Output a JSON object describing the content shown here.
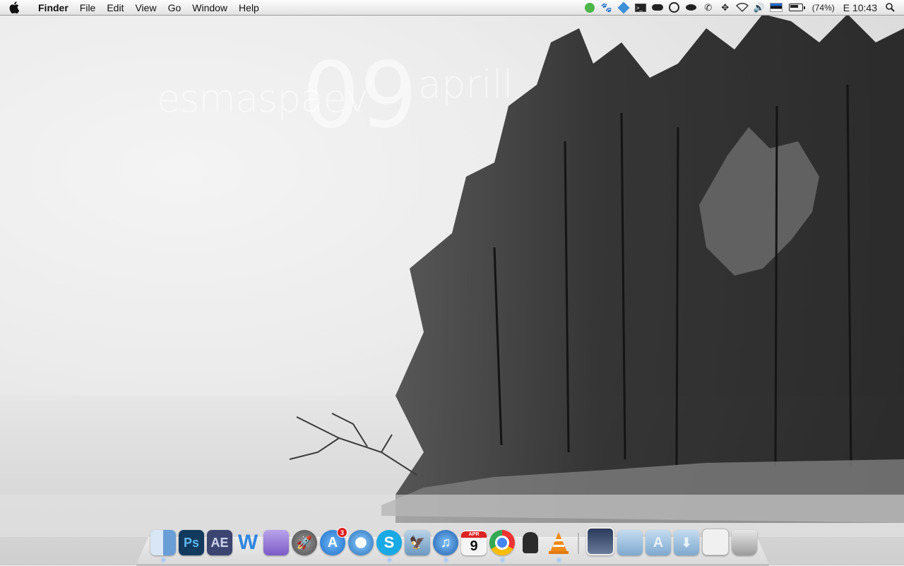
{
  "menubar": {
    "apple_icon": "apple-icon",
    "app_name": "Finder",
    "menus": [
      "File",
      "Edit",
      "View",
      "Go",
      "Window",
      "Help"
    ],
    "status_icons": [
      "evernote-icon",
      "paw-icon",
      "dropbox-icon",
      "terminal-icon",
      "cloud-icon",
      "sync-icon",
      "eye-icon",
      "phone-icon",
      "move-icon",
      "wifi-icon",
      "volume-icon",
      "estonian-flag-icon",
      "battery-icon",
      "search-icon"
    ],
    "battery_percent": "(74%)",
    "clock": "E 10:43"
  },
  "widget": {
    "day_name": "esmaspäev",
    "date_number": "09",
    "month_name": "aprill"
  },
  "dock": {
    "apps": [
      {
        "name": "finder-icon",
        "glyph": "",
        "color": "#6fa0d8",
        "running": true
      },
      {
        "name": "photoshop-icon",
        "glyph": "Ps",
        "color": "#1c3a5c"
      },
      {
        "name": "after-effects-icon",
        "glyph": "AE",
        "color": "#3d4f7a"
      },
      {
        "name": "word-icon",
        "glyph": "W",
        "color": "#2f7fd8"
      },
      {
        "name": "keynote-icon",
        "glyph": "",
        "color": "#8a72c6"
      },
      {
        "name": "launchpad-icon",
        "glyph": "",
        "color": "#7a7a7a"
      },
      {
        "name": "app-store-icon",
        "glyph": "",
        "color": "#2f86e0",
        "badge": "3"
      },
      {
        "name": "safari-icon",
        "glyph": "",
        "color": "#4a9ad8"
      },
      {
        "name": "skype-icon",
        "glyph": "S",
        "color": "#19a9e5",
        "running": true
      },
      {
        "name": "mail-icon",
        "glyph": "",
        "color": "#7aa8c8"
      },
      {
        "name": "itunes-icon",
        "glyph": "♫",
        "color": "#2c7ad0",
        "running": true
      },
      {
        "name": "calendar-icon",
        "glyph": "9",
        "color": "#f2f2f2"
      },
      {
        "name": "chrome-icon",
        "glyph": "",
        "color": "#d9d9d9",
        "running": true
      },
      {
        "name": "alfred-icon",
        "glyph": "",
        "color": "#3a3a3a"
      },
      {
        "name": "vlc-icon",
        "glyph": "",
        "color": "#f08a1a",
        "running": true
      }
    ],
    "stacks": [
      {
        "name": "desktop-stack-icon",
        "color": "#3a4a6a"
      },
      {
        "name": "documents-folder-icon",
        "color": "#8fb8dc"
      },
      {
        "name": "applications-folder-icon",
        "color": "#8fb8dc"
      },
      {
        "name": "downloads-folder-icon",
        "color": "#8fb8dc"
      },
      {
        "name": "screenshots-stack-icon",
        "color": "#e8e8e8"
      },
      {
        "name": "trash-icon",
        "color": "#bfbfbf"
      }
    ],
    "calendar_month": "APR",
    "calendar_day": "9"
  }
}
